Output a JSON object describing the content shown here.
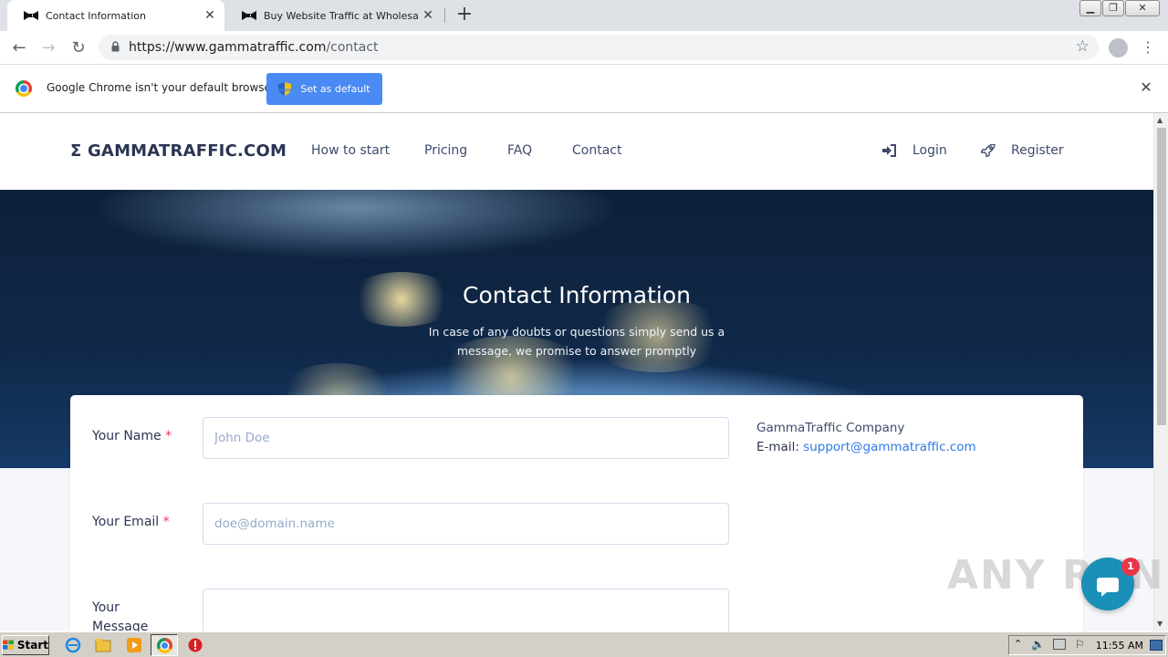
{
  "browser": {
    "tabs": [
      {
        "title": "Contact Information",
        "active": true
      },
      {
        "title": "Buy Website Traffic at Wholesale Ra",
        "active": false
      }
    ],
    "url": {
      "host": "https://www.gammatraffic.com",
      "path": "/contact"
    },
    "infobar": {
      "message": "Google Chrome isn't your default browser",
      "button_label": "Set as default"
    }
  },
  "site": {
    "logo": "Σ GAMMATRAFFIC.COM",
    "nav": [
      "How to start",
      "Pricing",
      "FAQ",
      "Contact"
    ],
    "login": "Login",
    "register": "Register"
  },
  "hero": {
    "title": "Contact Information",
    "subtitle": "In case of any doubts or questions simply send us a message, we promise to answer promptly"
  },
  "form": {
    "name_label": "Your Name",
    "name_placeholder": "John Doe",
    "email_label": "Your Email",
    "email_placeholder": "doe@domain.name",
    "message_label": "Your Message",
    "required_mark": "*"
  },
  "company": {
    "name": "GammaTraffic Company",
    "email_label": "E-mail:",
    "email": "support@gammatraffic.com"
  },
  "chat": {
    "badge_count": "1"
  },
  "watermark": "ANY RUN",
  "taskbar": {
    "start_label": "Start",
    "clock": "11:55 AM"
  },
  "colors": {
    "accent": "#2c7be5",
    "required": "#e63757",
    "chrome_button": "#4a8af4"
  }
}
